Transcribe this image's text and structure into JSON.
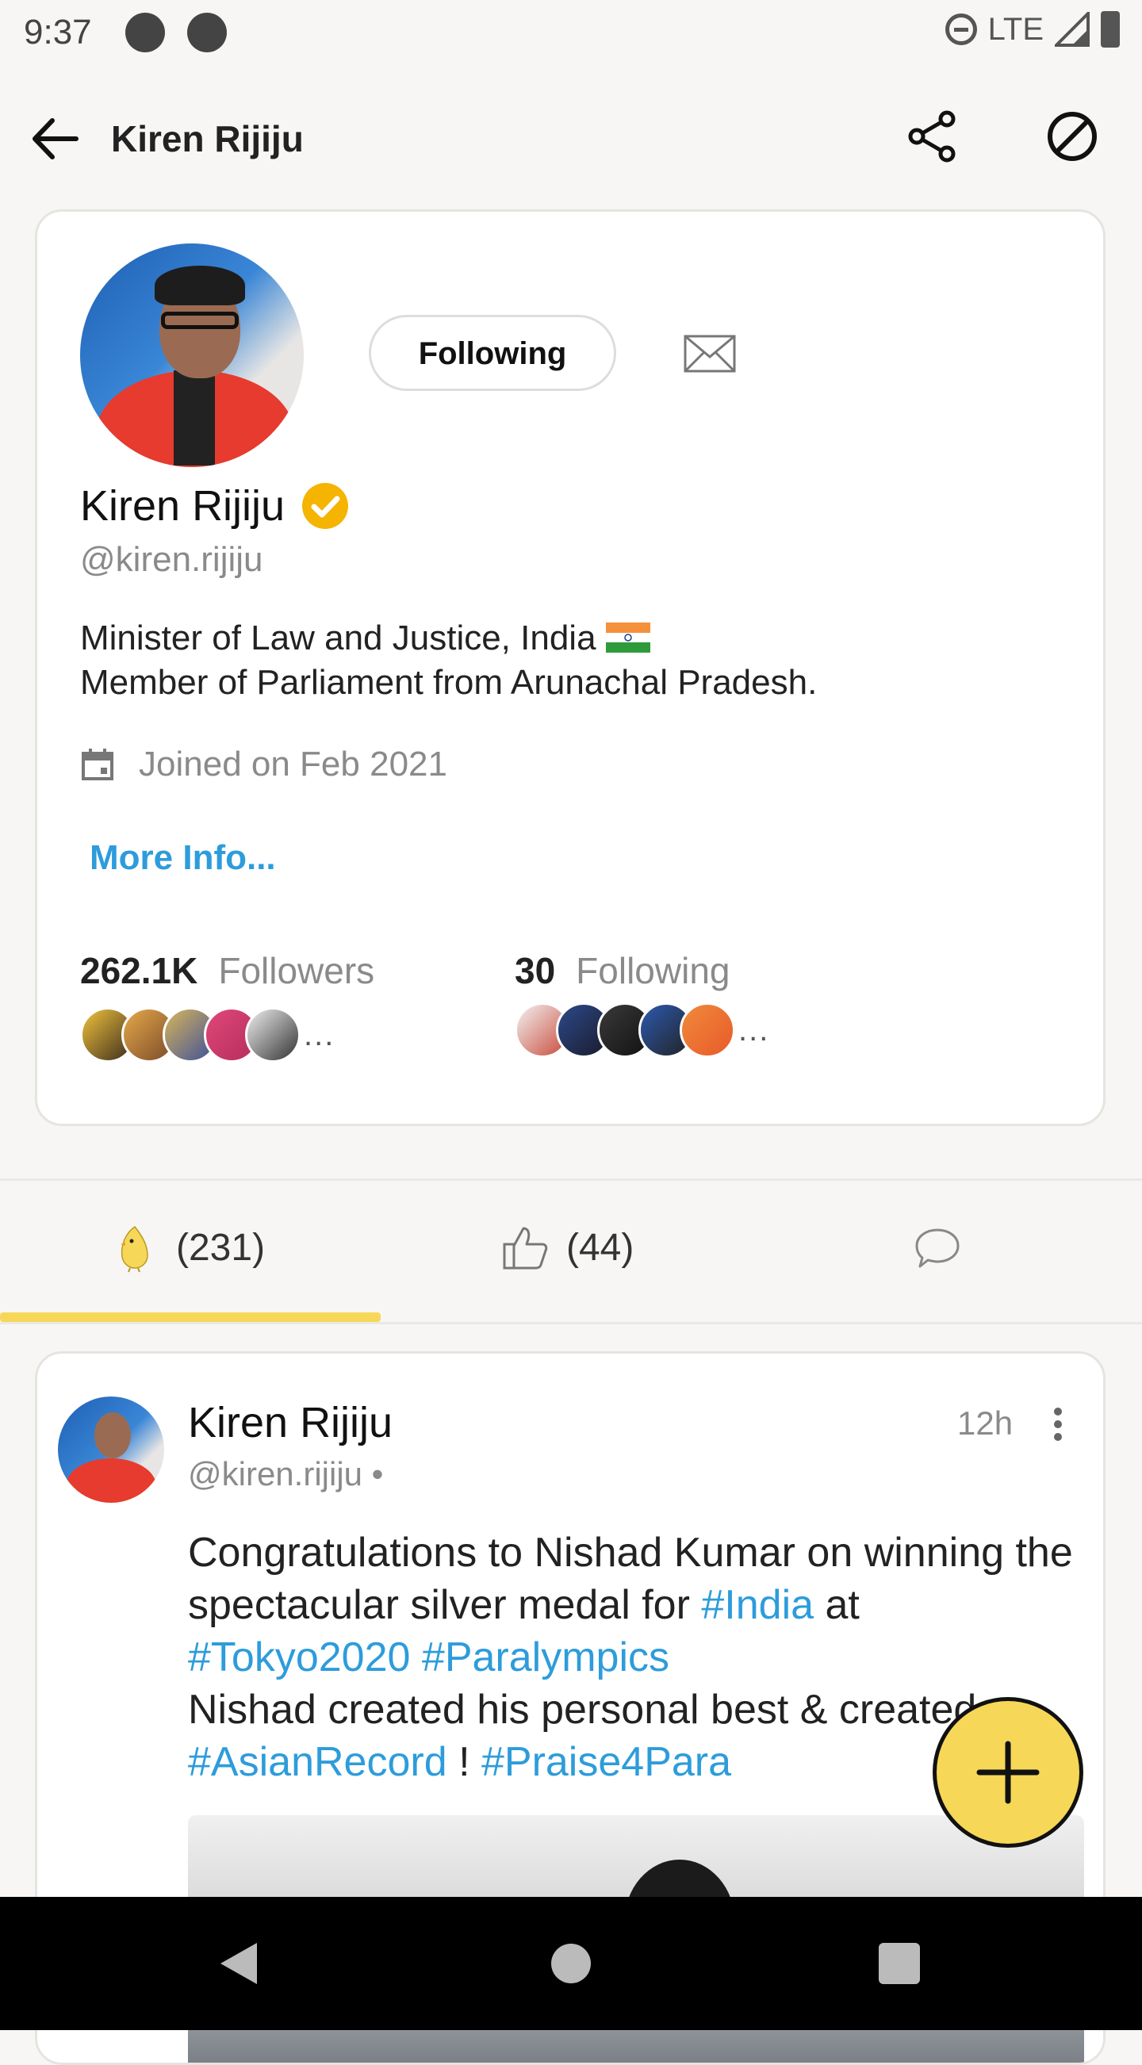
{
  "status_bar": {
    "time": "9:37",
    "network": "LTE"
  },
  "app_bar": {
    "title": "Kiren Rijiju"
  },
  "profile": {
    "follow_button": "Following",
    "name": "Kiren Rijiju",
    "handle": "@kiren.rijiju",
    "bio_line_1": "Minister of Law and Justice, India",
    "bio_line_2": "Member of Parliament from Arunachal Pradesh.",
    "joined": "Joined on Feb 2021",
    "more_info": "More Info...",
    "followers_count": "262.1K",
    "followers_label": "Followers",
    "following_count": "30",
    "following_label": "Following",
    "ellipsis": "..."
  },
  "tabs": [
    {
      "icon": "koo-bird-icon",
      "count": "(231)"
    },
    {
      "icon": "thumbs-up-icon",
      "count": "(44)"
    },
    {
      "icon": "comment-icon",
      "count": ""
    }
  ],
  "post": {
    "author": "Kiren Rijiju",
    "handle": "@kiren.rijiju •",
    "time": "12h",
    "text_1": "Congratulations to Nishad Kumar on winning the spectacular silver medal for ",
    "tag_india": "#India",
    "text_2": " at ",
    "tag_tokyo": "#Tokyo2020",
    "text_3": " ",
    "tag_paralympics": "#Paralympics",
    "text_4": "Nishad created his personal best & created an ",
    "tag_asian": "#AsianRecord",
    "text_5": " ! ",
    "tag_praise": "#Praise4Para"
  },
  "colors": {
    "accent_yellow": "#f7d757",
    "link_blue": "#2d9cdb",
    "verified_gold": "#f5b400"
  }
}
